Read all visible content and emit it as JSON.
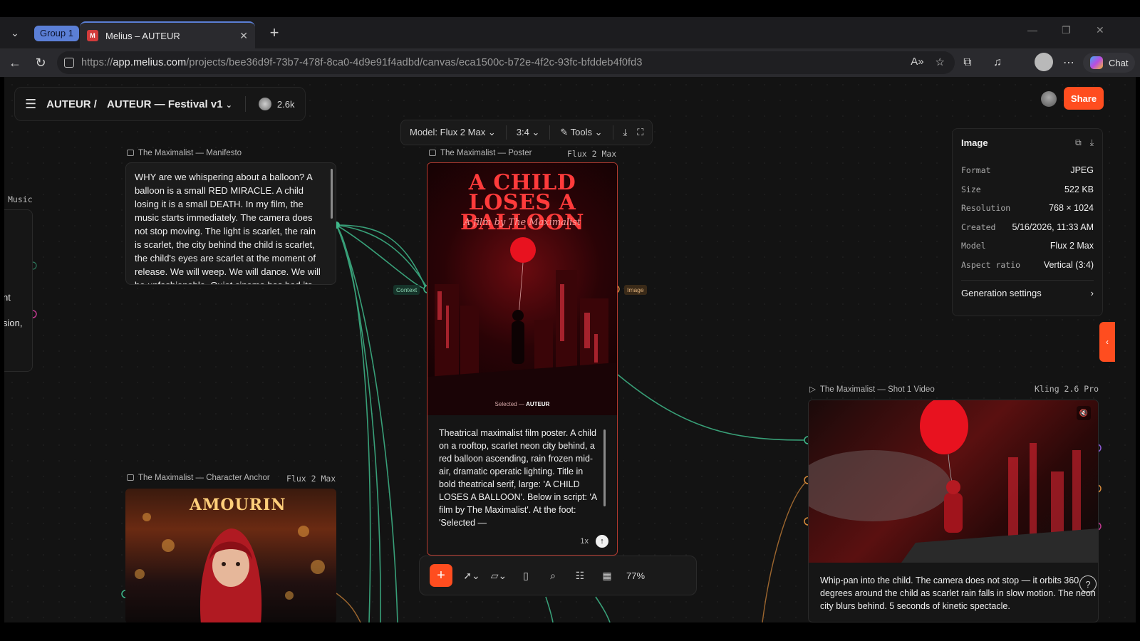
{
  "browser": {
    "group_label": "Group 1",
    "tab_title": "Melius – AUTEUR",
    "url_prefix": "https://",
    "url_host": "app.melius.com",
    "url_path": "/projects/bee36d9f-73b7-478f-8ca0-4d9e91f4adbd/canvas/eca1500c-b72e-4f2c-93fc-bfddeb4f0fd3",
    "chat_label": "Chat"
  },
  "app": {
    "breadcrumb_root": "AUTEUR /",
    "breadcrumb_project": "AUTEUR — Festival v1",
    "credits": "2.6k",
    "share_label": "Share",
    "accent_color": "#ff4d1f"
  },
  "node_toolbar": {
    "model": "Model: Flux 2 Max",
    "aspect": "3:4",
    "tools": "Tools"
  },
  "manifesto": {
    "label": "The Maximalist — Manifesto",
    "text": "WHY are we whispering about a balloon? A balloon is a small RED MIRACLE. A child losing it is a small DEATH. In my film, the music starts immediately. The camera does not stop moving. The light is scarlet, the rain is scarlet, the city behind the child is scarlet, the child's eyes are scarlet at the moment of release. We will weep. We will dance. We will be unfashionable. Quiet cinema has had its"
  },
  "poster": {
    "label": "The Maximalist — Poster",
    "model": "Flux 2 Max",
    "title": "A CHILD LOSES A BALLOON",
    "subtitle": "A film by The Maximalist",
    "foot_prefix": "Selected —",
    "foot_name": "AUTEUR",
    "prompt": "Theatrical maximalist film poster. A child on a rooftop, scarlet neon city behind, a red balloon ascending, rain frozen mid-air, dramatic operatic lighting. Title in bold theatrical serif, large: 'A CHILD LOSES A BALLOON'. Below in script: 'A film by The Maximalist'. At the foot: 'Selected —",
    "multiplier": "1x",
    "port_in": "Context",
    "port_out": "Image"
  },
  "character": {
    "label": "The Maximalist — Character Anchor",
    "model": "Flux 2 Max",
    "sign_text": "AMOURIN"
  },
  "video": {
    "label": "The Maximalist — Shot 1 Video",
    "model": "Kling 2.6 Pro",
    "text": "Whip-pan into the child. The camera does not stop — it orbits 360 degrees around the child as scarlet rain falls in slow motion. The neon city blurs behind. 5 seconds of kinetic spectacle."
  },
  "info_panel": {
    "title": "Image",
    "rows": [
      {
        "key": "Format",
        "value": "JPEG"
      },
      {
        "key": "Size",
        "value": "522 KB"
      },
      {
        "key": "Resolution",
        "value": "768 × 1024"
      },
      {
        "key": "Created",
        "value": "5/16/2026, 11:33 AM"
      },
      {
        "key": "Model",
        "value": "Flux 2 Max"
      },
      {
        "key": "Aspect ratio",
        "value": "Vertical (3:4)"
      }
    ],
    "generation_settings": "Generation settings"
  },
  "left_node": {
    "label": "Music",
    "frag1": "nt",
    "frag2": "sion,"
  },
  "bottom_toolbar": {
    "zoom": "77%"
  },
  "colors": {
    "wire": "#3fb88a",
    "port_magenta": "#c0398f",
    "port_orange": "#d98a3a",
    "port_purple": "#8f5bd6"
  }
}
